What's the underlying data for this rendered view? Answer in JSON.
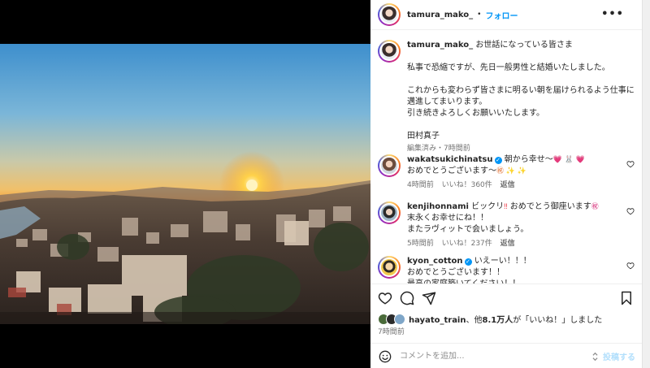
{
  "post_author": "tamura_mako_",
  "follow_label": "フォロー",
  "dot": "•",
  "more_glyph": "•••",
  "caption": {
    "username": "tamura_mako_",
    "lines": [
      "お世話になっている皆さま",
      "私事で恐縮ですが、先日一般男性と結婚いたしました。",
      "これからも変わらず皆さまに明るい朝を届けられるよう仕事に邁進してまいります。",
      "引き続きよろしくお願いいたします。",
      "田村真子"
    ],
    "edited": "編集済み",
    "sep": "・",
    "time": "7時間前"
  },
  "comments": [
    {
      "username": "wakatsukichinatsu",
      "verified": true,
      "text1": "朝から幸せ〜",
      "emoji1": "💗 🐰 💗",
      "text2": "おめでとうございます〜",
      "emoji2": "㊗ ✨ ✨",
      "time": "4時間前",
      "likes": "いいね！360件",
      "reply": "返信"
    },
    {
      "username": "kenjihonnami",
      "verified": false,
      "text1": "ビックリ",
      "emoji1": "‼",
      "text1b": "おめでとう御座います",
      "emoji1b": "㊗",
      "text2": "末永くお幸せにね！！",
      "text3": "またラヴィットで会いましょう。",
      "time": "5時間前",
      "likes": "いいね！237件",
      "reply": "返信"
    },
    {
      "username": "kyon_cotton",
      "verified": true,
      "text1": "いえーい！！！",
      "text2": "おめでとうございます！！",
      "text3": "最高の家庭築いてください！！"
    }
  ],
  "likes": {
    "bold_user": "hayato_train",
    "rest": "、他",
    "count": "8.1万人",
    "suffix": "が「いいね！」しました"
  },
  "post_time": "7時間前",
  "comment_input": {
    "placeholder": "コメントを追加...",
    "post_label": "投稿する"
  },
  "colors": {
    "accent": "#0095f6",
    "meta": "#737373",
    "like_heart": "#ed4956"
  },
  "icons": [
    "heart-icon",
    "comment-icon",
    "share-icon",
    "bookmark-icon",
    "emoji-icon",
    "more-icon"
  ]
}
